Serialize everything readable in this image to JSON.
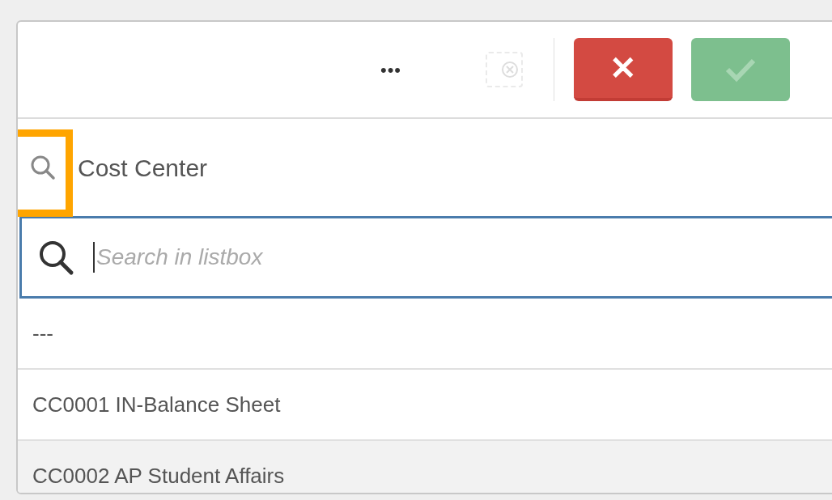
{
  "toolbar": {
    "more_label": "•••",
    "clear_selections_disabled": true,
    "cancel_label": "✕",
    "confirm_disabled": true
  },
  "listbox": {
    "title": "Cost Center",
    "highlighted": true,
    "search": {
      "placeholder": "Search in listbox",
      "focused": true
    },
    "rows": [
      {
        "label": "---",
        "shaded": false
      },
      {
        "label": "CC0001 IN-Balance Sheet",
        "shaded": false
      },
      {
        "label": "CC0002 AP Student Affairs",
        "shaded": true
      }
    ]
  }
}
